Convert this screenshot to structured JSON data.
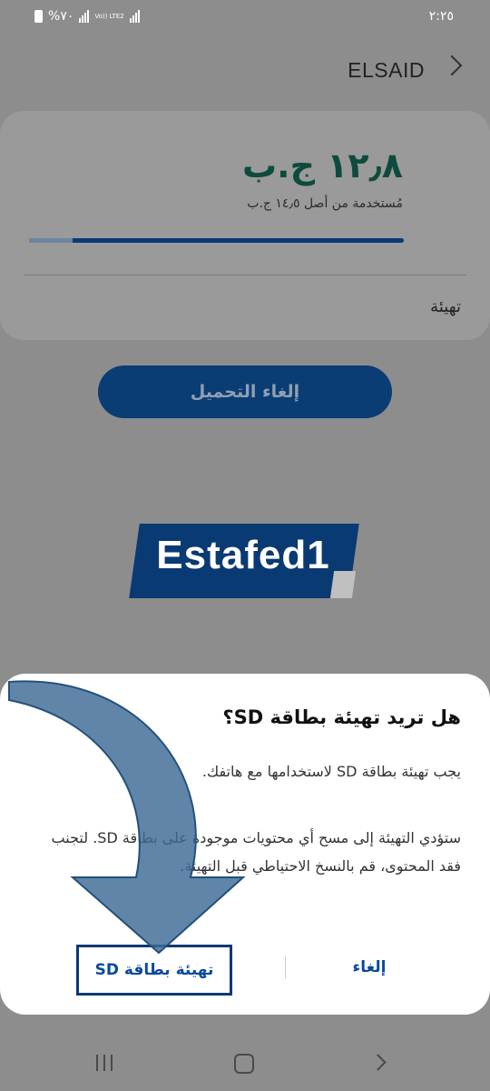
{
  "status_bar": {
    "battery_text": "%٧٠",
    "network_label": "Vo)) LTE2",
    "time": "٢:٢٥"
  },
  "header": {
    "title": "ELSAID",
    "icon": "chevron-right-icon"
  },
  "storage": {
    "used_amount": "١٢٫٨ ج.ب",
    "used_of_total": "مُستخدمة من أصل ١٤٫٥ ج.ب",
    "used_fraction": 0.883,
    "format_label": "تهيئة"
  },
  "cancel_download_label": "إلغاء التحميل",
  "watermark_text": "Estafed1",
  "dialog": {
    "title": "هل تريد تهيئة بطاقة SD؟",
    "message1": "يجب تهيئة بطاقة SD لاستخدامها مع هاتفك.",
    "message2": "ستؤدي التهيئة إلى مسح أي محتويات موجودة على بطاقة SD. لتجنب فقد المحتوى، قم بالنسخ الاحتياطي قبل التهيئة.",
    "cancel_label": "إلغاء",
    "format_label": "تهيئة بطاقة SD"
  },
  "colors": {
    "accent": "#0a3d73",
    "amount_text": "#0e4a3d",
    "dialog_button": "#0a4a9a"
  },
  "nav_icons": [
    "recents-icon",
    "home-icon",
    "back-icon"
  ]
}
